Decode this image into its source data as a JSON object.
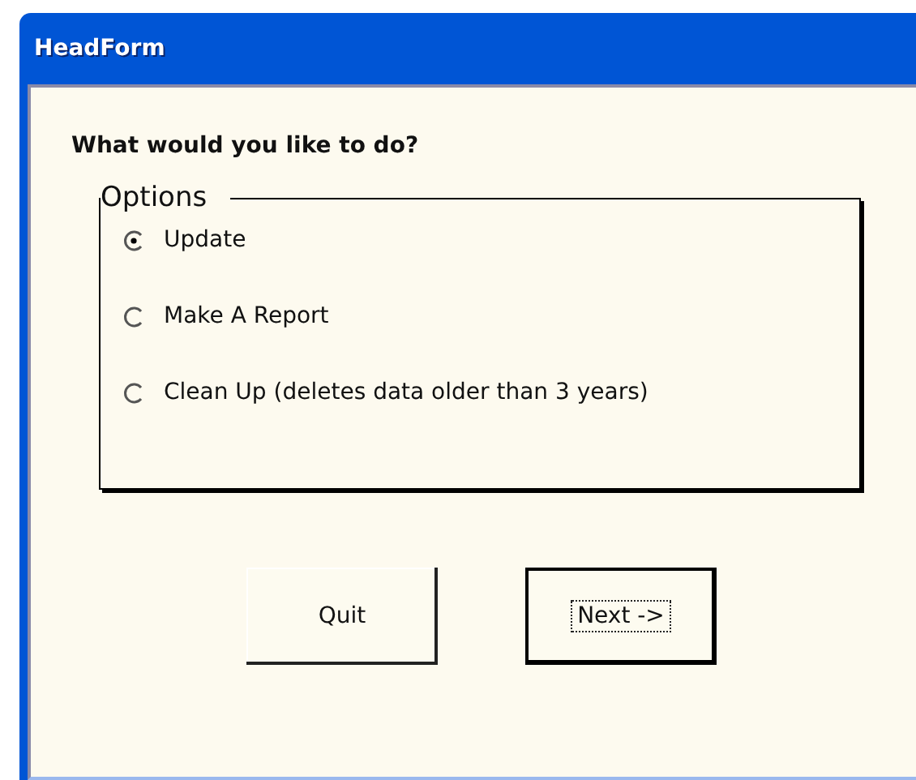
{
  "window": {
    "title": "HeadForm"
  },
  "prompt": "What would you like to do?",
  "options_group": {
    "label": "Options",
    "options": [
      {
        "label": "Update",
        "selected": true
      },
      {
        "label": "Make A Report",
        "selected": false
      },
      {
        "label": "Clean Up (deletes data older than 3 years)",
        "selected": false
      }
    ]
  },
  "buttons": [
    {
      "label": "Quit",
      "focused": false
    },
    {
      "label": "Next ->",
      "focused": true
    }
  ]
}
